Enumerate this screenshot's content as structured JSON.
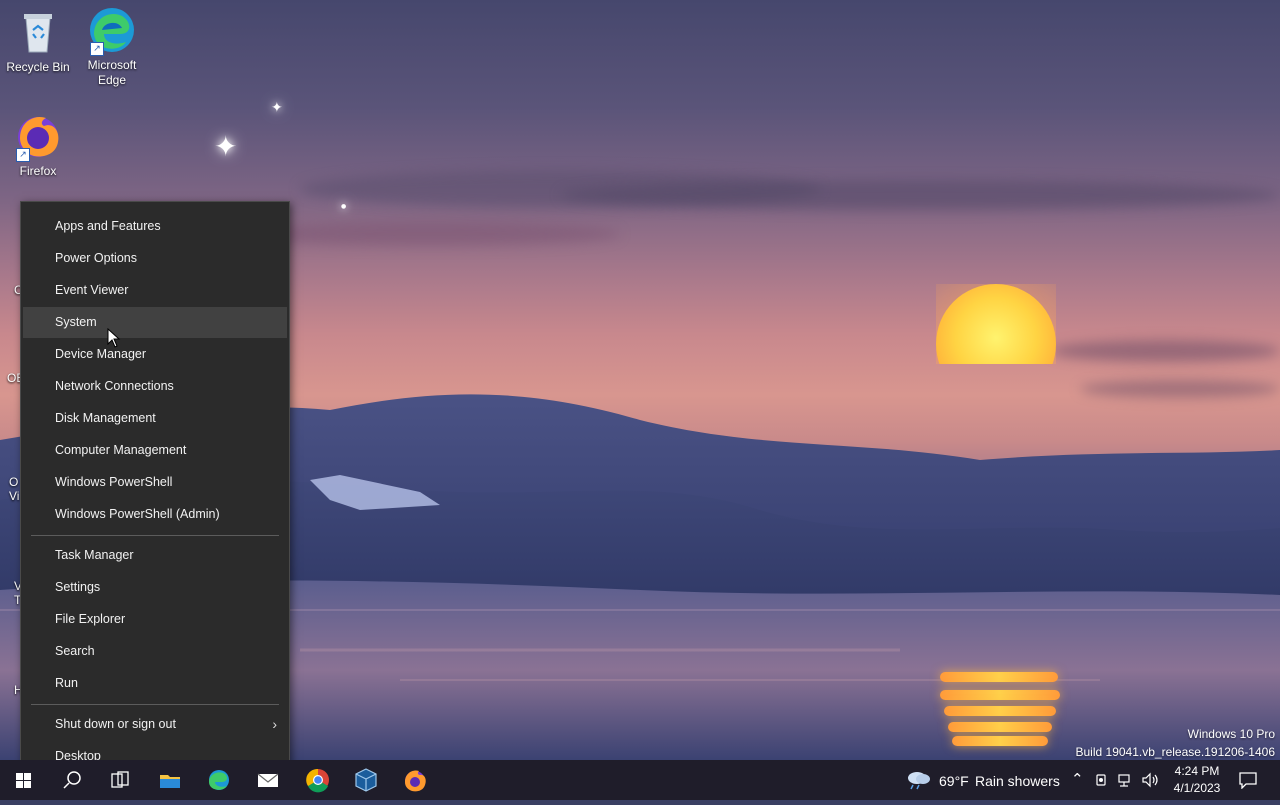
{
  "desktop": {
    "icons": [
      {
        "label": "Recycle Bin",
        "icon": "recycle-bin-icon"
      },
      {
        "label": "Microsoft Edge",
        "icon": "edge-icon"
      },
      {
        "label": "Firefox",
        "icon": "firefox-icon"
      }
    ],
    "partial_labels": [
      "C",
      "OB",
      "O",
      "Vi",
      "V",
      "T",
      "H"
    ]
  },
  "context_menu": {
    "group1": [
      "Apps and Features",
      "Power Options",
      "Event Viewer",
      "System",
      "Device Manager",
      "Network Connections",
      "Disk Management",
      "Computer Management",
      "Windows PowerShell",
      "Windows PowerShell (Admin)"
    ],
    "group2": [
      "Task Manager",
      "Settings",
      "File Explorer",
      "Search",
      "Run"
    ],
    "group3": [
      "Shut down or sign out",
      "Desktop"
    ],
    "hovered_item": "System",
    "submenu_arrow": "›"
  },
  "watermark": {
    "line1": "Windows 10 Pro",
    "line2": "Build 19041.vb_release.191206-1406"
  },
  "taskbar": {
    "apps": [
      "start-icon",
      "search-icon",
      "task-view-icon",
      "file-explorer-icon",
      "edge-icon",
      "mail-icon",
      "chrome-icon",
      "virtualbox-icon",
      "firefox-icon"
    ],
    "weather_temp": "69°F",
    "weather_text": "Rain showers",
    "time": "4:24 PM",
    "date": "4/1/2023",
    "colors": {
      "background": "#1f1d2a",
      "menu_bg": "#2b2b2b",
      "menu_hover": "#414141"
    }
  }
}
